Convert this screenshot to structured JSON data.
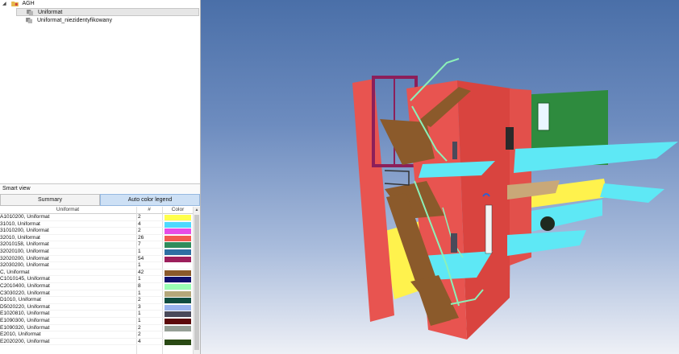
{
  "tree": {
    "root": {
      "label": "AGH"
    },
    "items": [
      {
        "label": "Uniformat"
      },
      {
        "label": "Uniformat_niezidentyfikowany"
      }
    ]
  },
  "smart_view": {
    "title": "Smart view",
    "tabs": [
      {
        "label": "Summary"
      },
      {
        "label": "Auto color legend"
      }
    ],
    "columns": [
      "Uniformat",
      "#",
      "Color"
    ],
    "rows": [
      {
        "name": "A1010200, Uniformat",
        "count": "2",
        "color": "#ffff4d"
      },
      {
        "name": "31010, Uniformat",
        "count": "4",
        "color": "#4dd9ff"
      },
      {
        "name": "31010200, Uniformat",
        "count": "2",
        "color": "#e64de6"
      },
      {
        "name": "32010, Uniformat",
        "count": "26",
        "color": "#f25a50"
      },
      {
        "name": "32010158, Uniformat",
        "count": "7",
        "color": "#2f8c5c"
      },
      {
        "name": "32020100, Uniformat",
        "count": "1",
        "color": "#2d6fa3"
      },
      {
        "name": "32020200, Uniformat",
        "count": "54",
        "color": "#9c1f5c"
      },
      {
        "name": "32030200, Uniformat",
        "count": "1",
        "color": "#ffffff"
      },
      {
        "name": "C, Uniformat",
        "count": "42",
        "color": "#8b5a2b"
      },
      {
        "name": "C1010145, Uniformat",
        "count": "1",
        "color": "#10106e"
      },
      {
        "name": "C2010400, Uniformat",
        "count": "8",
        "color": "#99ffb3"
      },
      {
        "name": "C3030220, Uniformat",
        "count": "1",
        "color": "#b5a77a"
      },
      {
        "name": "D1010, Uniformat",
        "count": "2",
        "color": "#0f4d40"
      },
      {
        "name": "D5020220, Uniformat",
        "count": "3",
        "color": "#99b3ee"
      },
      {
        "name": "E1020810, Uniformat",
        "count": "1",
        "color": "#4a4a5a"
      },
      {
        "name": "E1090300, Uniformat",
        "count": "1",
        "color": "#5c0a0a"
      },
      {
        "name": "E1090320, Uniformat",
        "count": "2",
        "color": "#96a096"
      },
      {
        "name": "E2010, Uniformat",
        "count": "2",
        "color": "#ffffff"
      },
      {
        "name": "E2020200, Uniformat",
        "count": "4",
        "color": "#2a4a14"
      }
    ]
  },
  "viewport": {
    "colors": {
      "sky_top": "#4a6fa8",
      "wall_red": "#e85450",
      "wall_green": "#2e8b3e",
      "slab_cyan": "#5ee8f5",
      "slab_yellow": "#fff24d",
      "stair_brown": "#8b5a2b",
      "railing_green": "#8cf0b8",
      "frame_purple": "#8c1f5a"
    }
  }
}
